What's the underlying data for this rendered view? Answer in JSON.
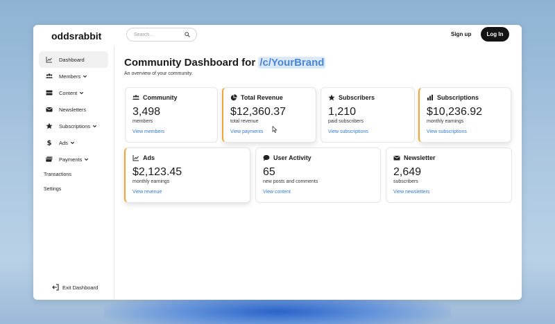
{
  "app": {
    "logo": "oddsrabbit"
  },
  "search": {
    "placeholder": "Search..."
  },
  "header": {
    "signup_label": "Sign up",
    "login_label": "Log In"
  },
  "sidebar": {
    "items": [
      {
        "label": "Dashboard",
        "icon": "chart-line-icon"
      },
      {
        "label": "Members",
        "icon": "users-icon"
      },
      {
        "label": "Content",
        "icon": "content-icon"
      },
      {
        "label": "Newsletters",
        "icon": "envelope-icon"
      },
      {
        "label": "Subscriptions",
        "icon": "star-icon"
      },
      {
        "label": "Ads",
        "icon": "dollar-icon"
      },
      {
        "label": "Payments",
        "icon": "payments-icon"
      }
    ],
    "plain_items": [
      "Transactions",
      "Settings"
    ],
    "exit_label": "Exit Dashboard"
  },
  "page": {
    "title_prefix": "Community Dashboard for ",
    "brand": "/c/YourBrand",
    "subtitle": "An overview of your community."
  },
  "cards": [
    {
      "title": "Community",
      "value": "3,498",
      "sub": "members",
      "link": "View members",
      "icon": "users-icon"
    },
    {
      "title": "Total Revenue",
      "value": "$12,360.37",
      "sub": "total revenue",
      "link": "View payments",
      "icon": "pie-chart-icon"
    },
    {
      "title": "Subscribers",
      "value": "1,210",
      "sub": "paid subscribers",
      "link": "View subscriptions",
      "icon": "star-icon"
    },
    {
      "title": "Subscriptions",
      "value": "$10,236.92",
      "sub": "monthly earnings",
      "link": "View subscriptions",
      "icon": "bar-chart-icon"
    },
    {
      "title": "Ads",
      "value": "$2,123.45",
      "sub": "monthly earnings",
      "link": "View revenue",
      "icon": "chart-line-icon"
    },
    {
      "title": "User Activity",
      "value": "65",
      "sub": "new posts and comments",
      "link": "View content",
      "icon": "comment-icon"
    },
    {
      "title": "Newsletter",
      "value": "2,649",
      "sub": "subscribers",
      "link": "View newsletters",
      "icon": "envelope-icon"
    }
  ],
  "colors": {
    "accent": "#f0a53a",
    "link": "#2f7bd6",
    "brand": "#4a86d8"
  }
}
